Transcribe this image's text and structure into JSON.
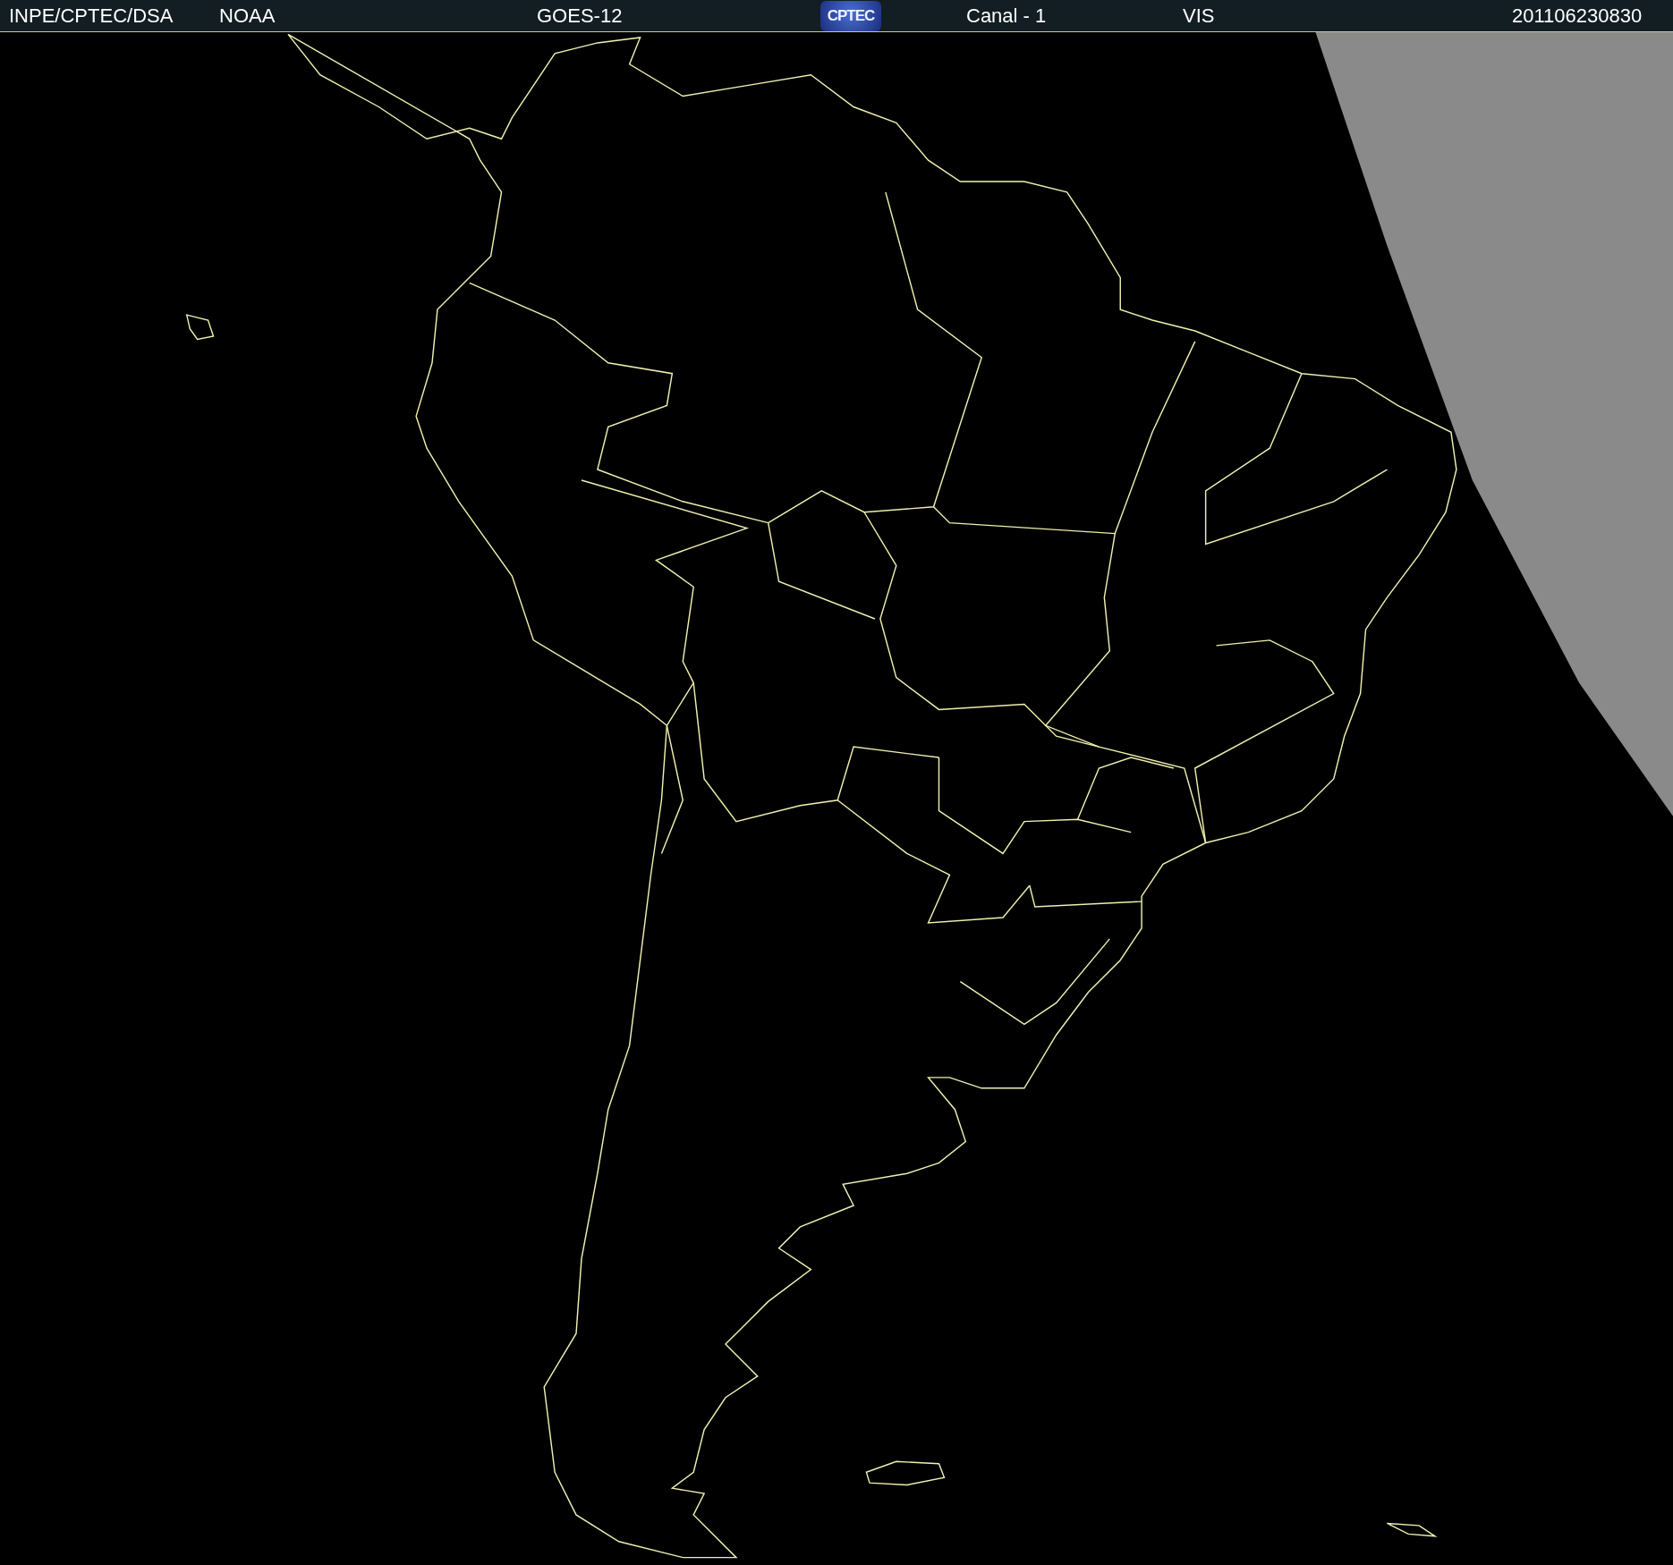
{
  "header": {
    "source": "INPE/CPTEC/DSA",
    "agency": "NOAA",
    "satellite": "GOES-12",
    "logo": "CPTEC",
    "channel": "Canal - 1",
    "band": "VIS",
    "timestamp": "201106230830"
  }
}
